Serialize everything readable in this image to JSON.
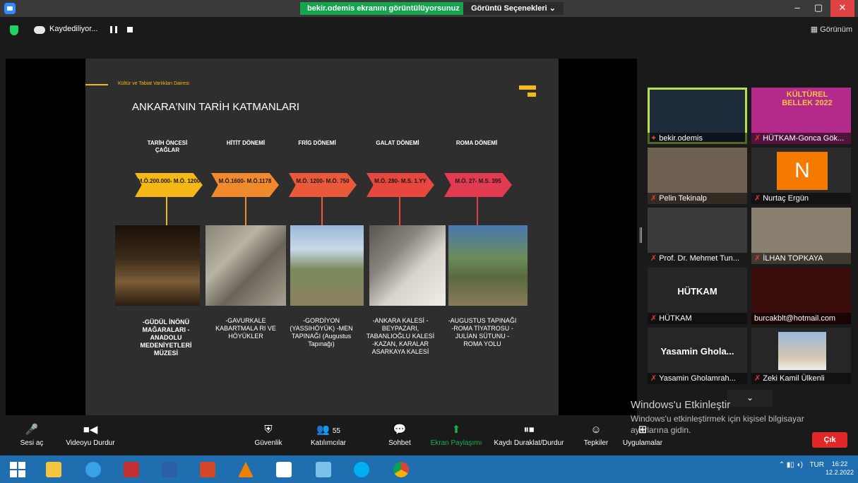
{
  "titlebar": {
    "share_banner": "bekir.odemis ekranını görüntülüyorsunuz",
    "view_options": "Görüntü Seçenekleri ⌄",
    "minimize": "–",
    "restore": "▢",
    "close": "✕"
  },
  "recording": {
    "label": "Kaydediliyor..."
  },
  "top_right": {
    "view_label": "Görünüm",
    "view_icon": "grid-icon"
  },
  "slide": {
    "department": "Kültür ve Tabiat Varlıkları Dairesi",
    "title": "ANKARA'NIN TARİH KATMANLARI",
    "columns": [
      {
        "heading": "TARİH ÖNCESİ ÇAĞLAR",
        "period": "M.Ö.200.000- M.Ö. 1200",
        "color": "#f5b815",
        "text": "-GÜDÜL İNÖNÜ MAĞARALARI -ANADOLU MEDENİYETLERİ MÜZESİ"
      },
      {
        "heading": "HİTİT DÖNEMİ",
        "period": "M.Ö.1600- M.Ö.1178",
        "color": "#f08a2c",
        "text": "-GAVURKALE KABARTMALA RI VE HÖYÜKLER"
      },
      {
        "heading": "FRİG DÖNEMİ",
        "period": "M.Ö. 1200- M.Ö. 750",
        "color": "#ea5a3a",
        "text": "-GORDİYON (YASSIHÖYÜK) -MEN TAPINAĞI (Augustus Tapınağı)"
      },
      {
        "heading": "GALAT DÖNEMİ",
        "period": "M.Ö. 280- M.S. 1.YY",
        "color": "#e8473d",
        "text": "-ANKARA KALESİ -BEYPAZARI, TABANLIOĞLU KALESİ -KAZAN, KARALAR ASARKAYA KALESİ"
      },
      {
        "heading": "ROMA DÖNEMİ",
        "period": "M.Ö. 27- M.S. 395",
        "color": "#e23a50",
        "text": "-AUGUSTUS TAPINAĞI -ROMA TİYATROSU -JULİAN SÜTUNU -ROMA YOLU"
      }
    ]
  },
  "participants": [
    {
      "name": "bekir.odemis",
      "active": true,
      "bg": "#1d2a3a"
    },
    {
      "name": "HÜTKAM-Gonca Gök...",
      "bg": "#b42a8a",
      "overlay": "KÜLTÜREL BELLEK 2022"
    },
    {
      "name": "Pelin Tekinalp",
      "bg": "#6d6050"
    },
    {
      "name": "Nurtaç Ergün",
      "bg": "#2b2b2b",
      "initial": "N"
    },
    {
      "name": "Prof. Dr. Mehmet Tun...",
      "bg": "#3a3a3a"
    },
    {
      "name": "İLHAN TOPKAYA",
      "bg": "#8a8070"
    },
    {
      "name": "HÜTKAM",
      "bg": "#262626",
      "big": "HÜTKAM"
    },
    {
      "name": "burcakblt@hotmail.com",
      "bg": "#3a0c0c",
      "no_mic": true
    },
    {
      "name": "Yasamin Gholamrah...",
      "bg": "#262626",
      "big": "Yasamin Ghola..."
    },
    {
      "name": "Zeki Kamil Ülkenli",
      "bg": "#262626"
    }
  ],
  "watermark": {
    "title": "Windows'u Etkinleştir",
    "subtitle": "Windows'u etkinleştirmek için kişisel bilgisayar ayarlarına gidin."
  },
  "toolbar": {
    "mute": "Sesi aç",
    "video": "Videoyu Durdur",
    "security": "Güvenlik",
    "participants": "Katılımcılar",
    "participant_count": "55",
    "chat": "Sohbet",
    "share": "Ekran Paylaşımı",
    "record": "Kaydı Duraklat/Durdur",
    "reactions": "Tepkiler",
    "apps": "Uygulamalar",
    "leave": "Çık"
  },
  "taskbar": {
    "tray_lang": "TUR",
    "time": "16:22",
    "date": "12.2.2022"
  },
  "colors": {
    "accent": "#2d8cff",
    "share_green": "#14a44d",
    "active_border": "#b9e04a",
    "leave_red": "#e02828"
  }
}
